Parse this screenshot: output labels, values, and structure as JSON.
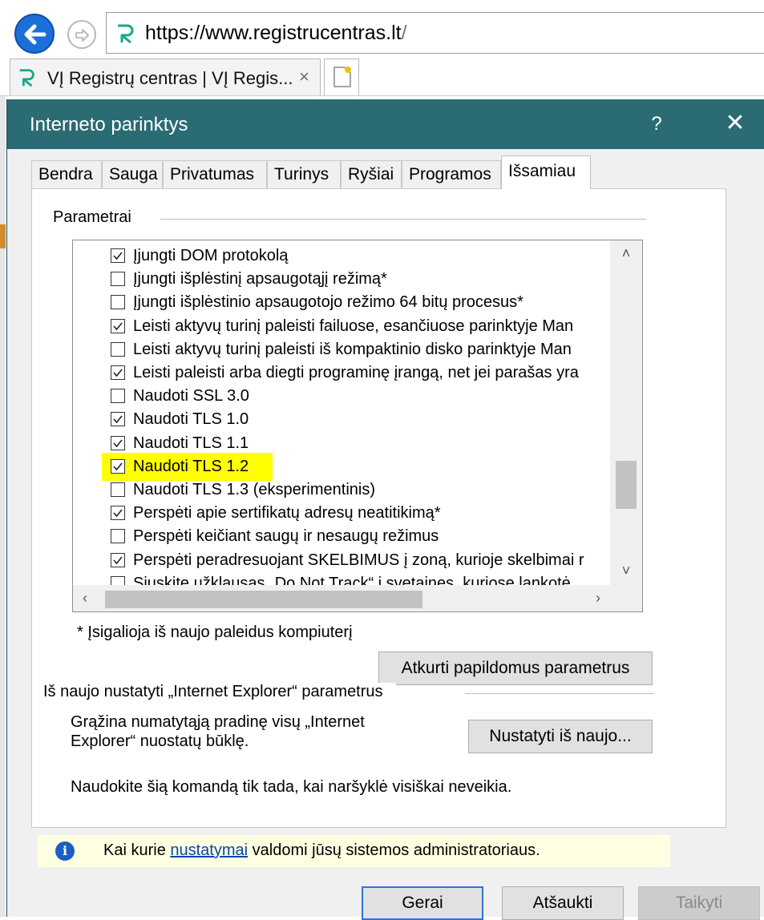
{
  "browser": {
    "url_scheme": "https://",
    "url_domain": "www.registrucentras.lt",
    "url_path": "/",
    "tab_title": "VĮ Registrų centras | VĮ Regis...",
    "tab_close": "×"
  },
  "dialog": {
    "title": "Interneto parinktys",
    "help_label": "?",
    "close_label": "✕",
    "tabs": [
      "Bendra",
      "Sauga",
      "Privatumas",
      "Turinys",
      "Ryšiai",
      "Programos",
      "Išsamiau"
    ],
    "active_tab": "Išsamiau",
    "settings_group_label": "Parametrai",
    "settings": [
      {
        "label": "Įjungti DOM protokolą",
        "checked": true
      },
      {
        "label": "Įjungti išplėstinį apsaugotąjį režimą*",
        "checked": false
      },
      {
        "label": "Įjungti išplėstinio apsaugotojo režimo 64 bitų procesus*",
        "checked": false
      },
      {
        "label": "Leisti aktyvų turinį paleisti failuose, esančiuose parinktyje Man",
        "checked": true
      },
      {
        "label": "Leisti aktyvų turinį paleisti iš kompaktinio disko parinktyje Man",
        "checked": false
      },
      {
        "label": "Leisti paleisti arba diegti programinę įrangą, net jei parašas yra",
        "checked": true
      },
      {
        "label": "Naudoti SSL 3.0",
        "checked": false
      },
      {
        "label": "Naudoti TLS 1.0",
        "checked": true
      },
      {
        "label": "Naudoti TLS 1.1",
        "checked": true
      },
      {
        "label": "Naudoti TLS 1.2",
        "checked": true
      },
      {
        "label": "Naudoti TLS 1.3 (eksperimentinis)",
        "checked": false
      },
      {
        "label": "Perspėti apie sertifikatų adresų neatitikimą*",
        "checked": true
      },
      {
        "label": "Perspėti keičiant saugų ir nesaugų režimus",
        "checked": false
      },
      {
        "label": "Perspėti peradresuojant SKELBIMUS į zoną, kurioje skelbimai r",
        "checked": true
      },
      {
        "label": "Siųskite užklausas „Do Not Track“ į svetaines, kuriose lankotė",
        "checked": false
      }
    ],
    "restart_note": "* Įsigalioja iš naujo paleidus kompiuterį",
    "restore_button": "Atkurti papildomus parametrus",
    "reset_group_label": "Iš naujo nustatyti „Internet Explorer“ parametrus",
    "reset_description": "Grąžina numatytąją pradinę visų „Internet Explorer“ nuostatų būklę.",
    "reset_button": "Nustatyti iš naujo...",
    "reset_warning": "Naudokite šią komandą tik tada, kai naršyklė visiškai neveikia.",
    "info_prefix": "Kai kurie ",
    "info_link": "nustatymai",
    "info_suffix": " valdomi jūsų sistemos administratoriaus.",
    "ok_button": "Gerai",
    "cancel_button": "Atšaukti",
    "apply_button": "Taikyti"
  },
  "colors": {
    "titlebar": "#2b6b73",
    "highlight": "#ffff00",
    "infobar": "#ffffe1",
    "link": "#0645ad",
    "default_button_border": "#2f73d9"
  },
  "icons": [
    "back-arrow-icon",
    "forward-arrow-icon",
    "site-logo-icon",
    "new-tab-icon",
    "info-icon",
    "checkmark-icon"
  ]
}
